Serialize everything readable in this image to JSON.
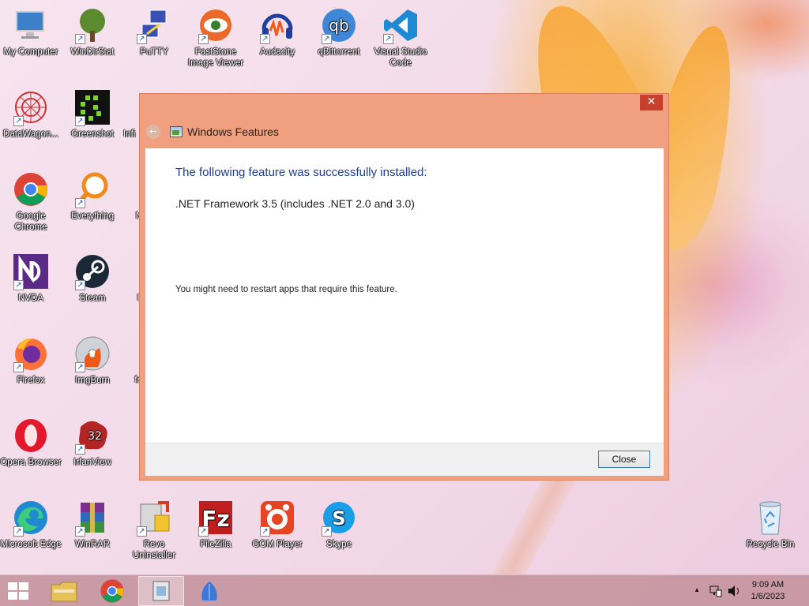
{
  "desktop": {
    "icons": [
      {
        "label": "My Computer",
        "icon": "computer-icon"
      },
      {
        "label": "WinDirStat",
        "icon": "tree-icon"
      },
      {
        "label": "PuTTY",
        "icon": "putty-icon"
      },
      {
        "label": "FastStone Image Viewer",
        "icon": "eye-icon"
      },
      {
        "label": "Audacity",
        "icon": "headphones-icon"
      },
      {
        "label": "qBittorrent",
        "icon": "qb-icon"
      },
      {
        "label": "Visual Studio Code",
        "icon": "vscode-icon"
      },
      {
        "label": "DataWagon...",
        "icon": "mandala-icon"
      },
      {
        "label": "Greenshot",
        "icon": "greenshot-icon"
      },
      {
        "label": "Infi",
        "icon": "partial-icon"
      },
      {
        "label": "Google Chrome",
        "icon": "chrome-icon"
      },
      {
        "label": "Everything",
        "icon": "magnifier-icon"
      },
      {
        "label": "N",
        "icon": "partial-icon"
      },
      {
        "label": "NVDA",
        "icon": "nvda-icon"
      },
      {
        "label": "Steam",
        "icon": "steam-icon"
      },
      {
        "label": "L",
        "icon": "partial-icon"
      },
      {
        "label": "Firefox",
        "icon": "firefox-icon"
      },
      {
        "label": "ImgBurn",
        "icon": "disc-icon"
      },
      {
        "label": "fo",
        "icon": "partial-icon"
      },
      {
        "label": "Opera Browser",
        "icon": "opera-icon"
      },
      {
        "label": "IrfanView",
        "icon": "irfanview-icon"
      },
      {
        "label": "Microsoft Edge",
        "icon": "edge-icon"
      },
      {
        "label": "WinRAR",
        "icon": "winrar-icon"
      },
      {
        "label": "Revo Uninstaller",
        "icon": "revo-icon"
      },
      {
        "label": "FileZilla",
        "icon": "filezilla-icon"
      },
      {
        "label": "GOM Player",
        "icon": "gom-icon"
      },
      {
        "label": "Skype",
        "icon": "skype-icon"
      },
      {
        "label": "Recycle Bin",
        "icon": "recycle-bin-icon"
      }
    ]
  },
  "dialog": {
    "title": "Windows Features",
    "close_glyph": "✕",
    "back_glyph": "←",
    "heading": "The following feature was successfully installed:",
    "feature": ".NET Framework 3.5 (includes .NET 2.0 and 3.0)",
    "note": "You might need to restart apps that require this feature.",
    "close_button": "Close",
    "heading_color": "#1e3c8c"
  },
  "taskbar": {
    "time": "9:09 AM",
    "date": "1/6/2023",
    "tray_arrow": "▲"
  }
}
